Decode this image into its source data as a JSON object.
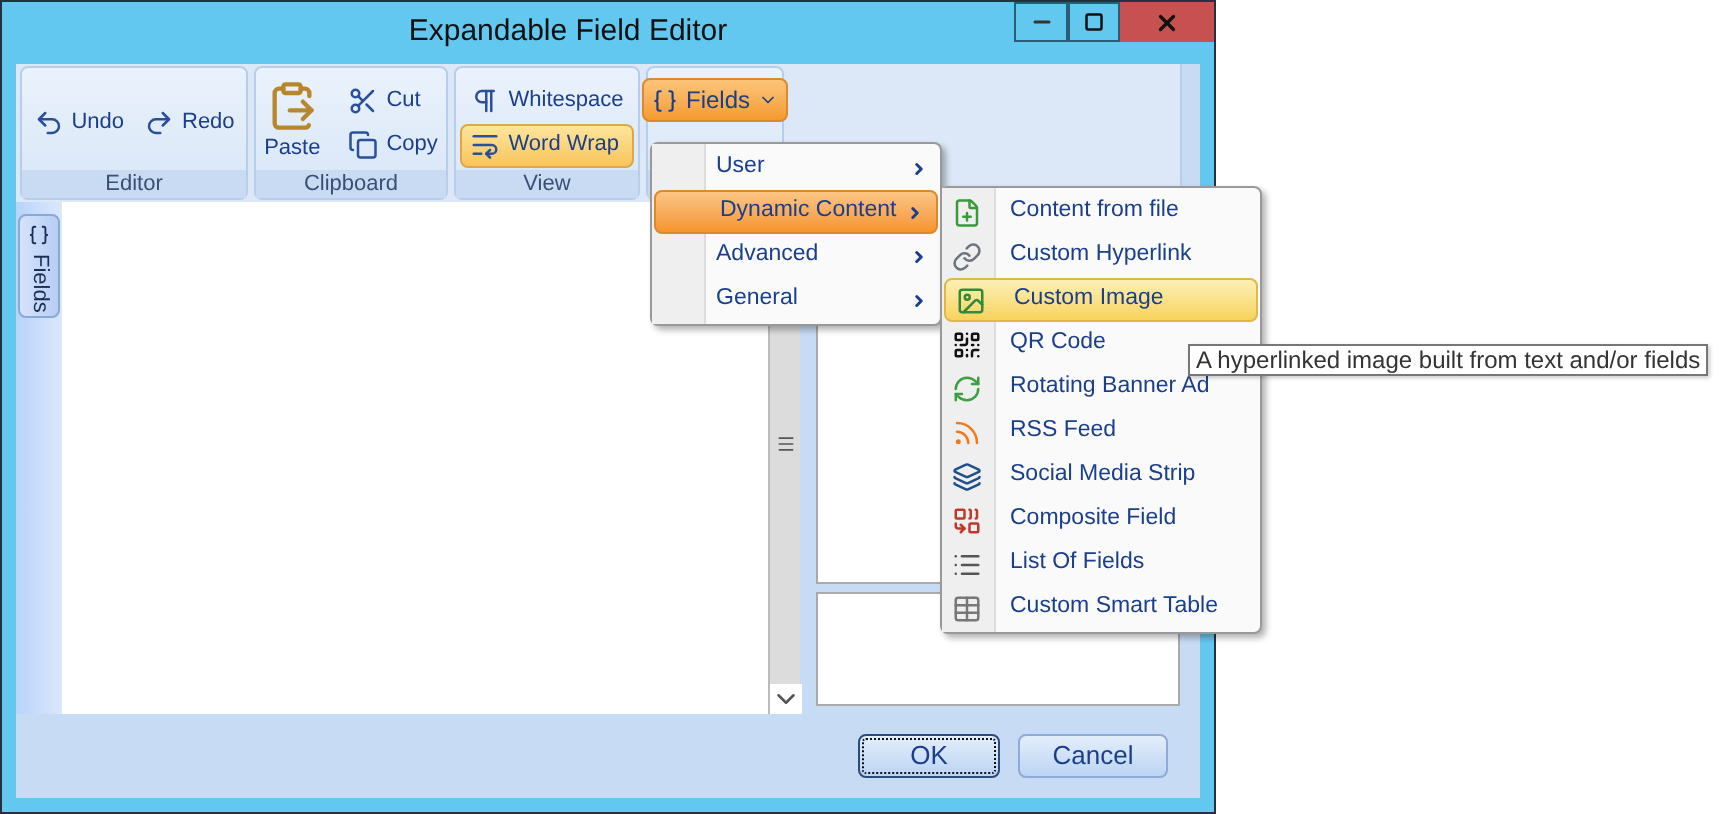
{
  "window": {
    "title": "Expandable Field Editor"
  },
  "ribbon": {
    "groups": [
      {
        "label": "Editor",
        "items": [
          {
            "label": "Undo",
            "selected": false
          },
          {
            "label": "Redo",
            "selected": false
          }
        ]
      },
      {
        "label": "Clipboard",
        "items": [
          {
            "label": "Paste",
            "selected": false
          },
          {
            "label": "Cut",
            "selected": false
          },
          {
            "label": "Copy",
            "selected": false
          }
        ]
      },
      {
        "label": "View",
        "items": [
          {
            "label": "Whitespace",
            "selected": false
          },
          {
            "label": "Word Wrap",
            "selected": true
          }
        ]
      },
      {
        "items": [
          {
            "label": "Fields",
            "selected": true
          }
        ]
      }
    ]
  },
  "side_tab": {
    "label": "Fields"
  },
  "menu": {
    "items": [
      {
        "label": "User",
        "selected": false
      },
      {
        "label": "Dynamic Content",
        "selected": true
      },
      {
        "label": "Advanced",
        "selected": false
      },
      {
        "label": "General",
        "selected": false
      }
    ]
  },
  "submenu": {
    "items": [
      {
        "label": "Content from file",
        "selected": false
      },
      {
        "label": "Custom Hyperlink",
        "selected": false
      },
      {
        "label": "Custom Image",
        "selected": true
      },
      {
        "label": "QR Code",
        "selected": false
      },
      {
        "label": "Rotating Banner Ad",
        "selected": false
      },
      {
        "label": "RSS Feed",
        "selected": false
      },
      {
        "label": "Social Media Strip",
        "selected": false
      },
      {
        "label": "Composite Field",
        "selected": false
      },
      {
        "label": "List Of Fields",
        "selected": false
      },
      {
        "label": "Custom Smart Table",
        "selected": false
      }
    ]
  },
  "tooltip": {
    "text": "A hyperlinked image built from text and/or fields"
  },
  "buttons": [
    {
      "label": "OK",
      "default": true
    },
    {
      "label": "Cancel",
      "default": false
    }
  ]
}
